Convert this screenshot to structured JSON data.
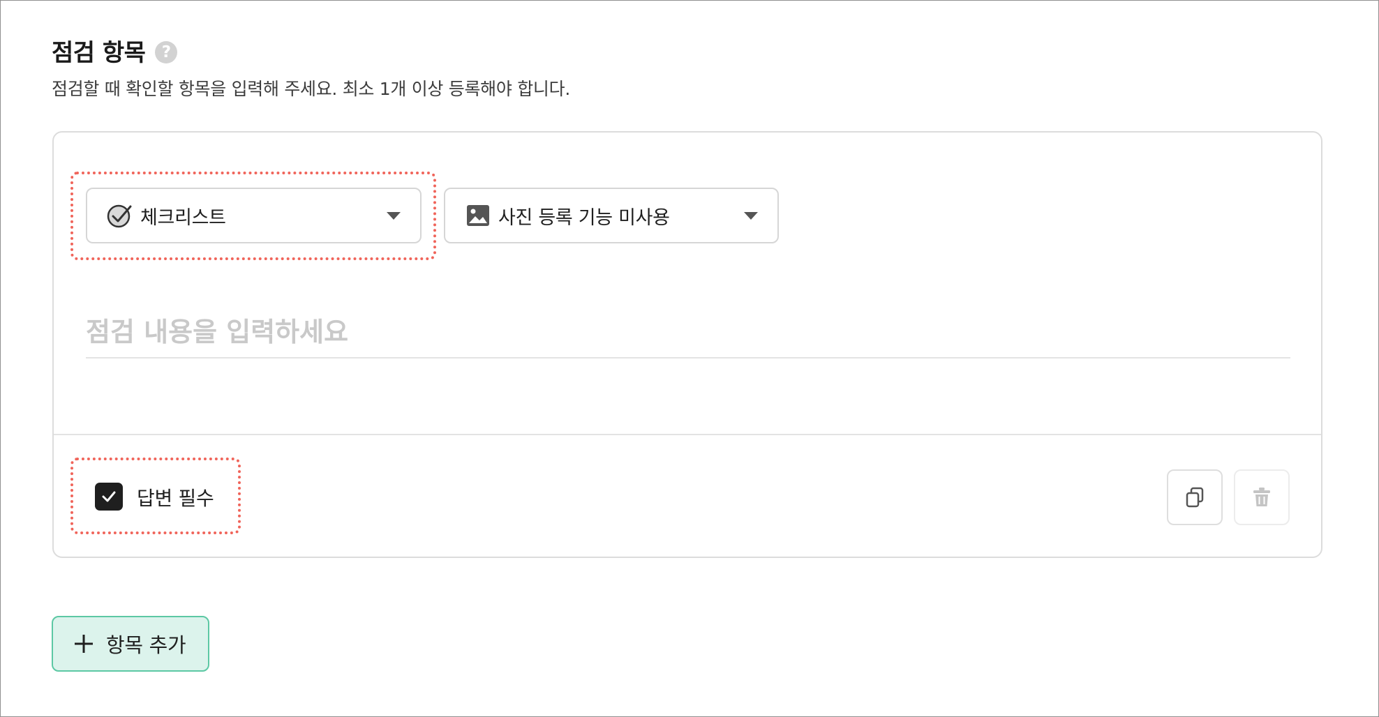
{
  "section": {
    "title": "점검 항목",
    "help_icon": "?",
    "description": "점검할 때 확인할 항목을 입력해 주세요. 최소 1개 이상 등록해야 합니다."
  },
  "item": {
    "type_select": {
      "value": "체크리스트",
      "icon": "check-circle-icon"
    },
    "photo_select": {
      "value": "사진 등록 기능 미사용",
      "icon": "image-icon"
    },
    "content": {
      "placeholder": "점검 내용을 입력하세요",
      "value": ""
    },
    "required": {
      "label": "답변 필수",
      "checked": true
    },
    "actions": {
      "copy_icon": "copy-icon",
      "delete_icon": "trash-icon"
    }
  },
  "add_item": {
    "label": "항목 추가",
    "icon": "plus-icon"
  },
  "colors": {
    "highlight": "#f0645a",
    "add_button_bg": "#dcf3ec",
    "add_button_border": "#5cc8a4",
    "checkbox": "#1f1f1f"
  }
}
